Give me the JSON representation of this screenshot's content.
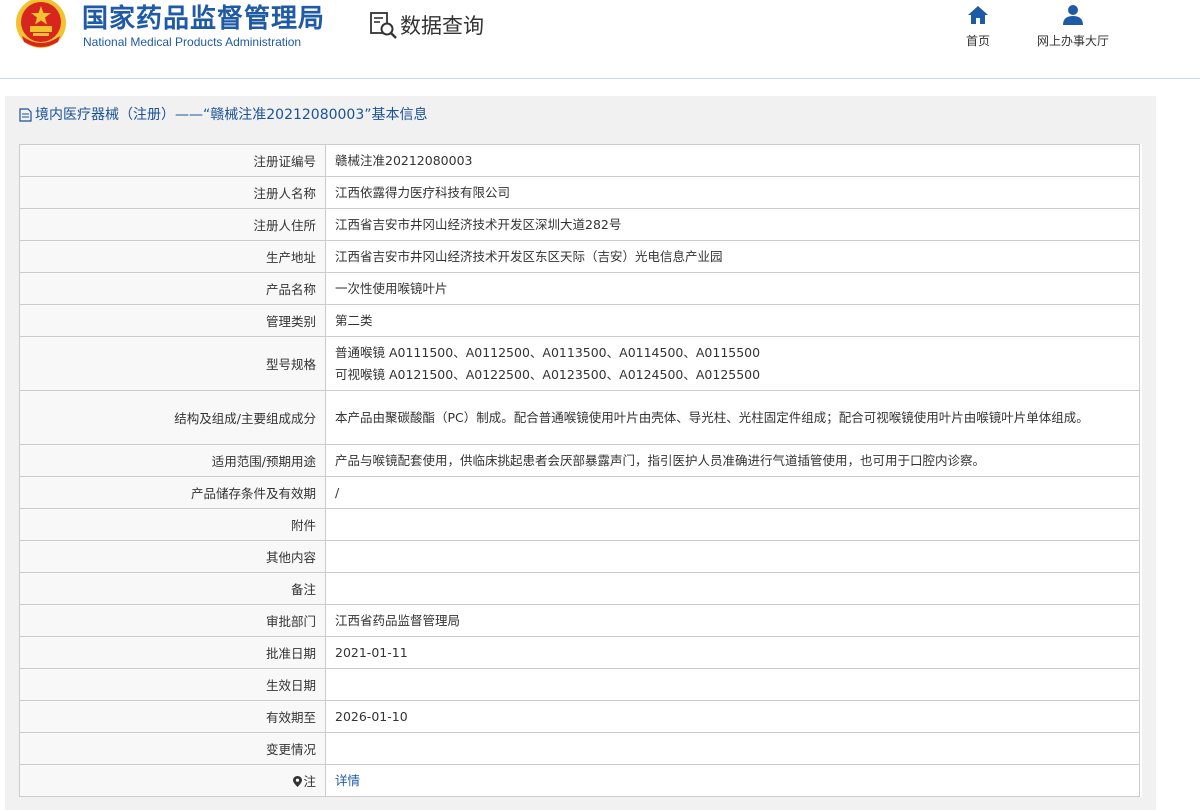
{
  "header": {
    "org_cn": "国家药品监督管理局",
    "org_en": "National Medical Products Administration",
    "query_label": "数据查询",
    "nav": {
      "home": "首页",
      "hall": "网上办事大厅"
    }
  },
  "panel": {
    "title": "境内医疗器械（注册）——“赣械注准20212080003”基本信息"
  },
  "rows": [
    {
      "label": "注册证编号",
      "value": "赣械注准20212080003"
    },
    {
      "label": "注册人名称",
      "value": "江西依露得力医疗科技有限公司"
    },
    {
      "label": "注册人住所",
      "value": "江西省吉安市井冈山经济技术开发区深圳大道282号"
    },
    {
      "label": "生产地址",
      "value": "江西省吉安市井冈山经济技术开发区东区天际（吉安）光电信息产业园"
    },
    {
      "label": "产品名称",
      "value": "一次性使用喉镜叶片"
    },
    {
      "label": "管理类别",
      "value": "第二类"
    },
    {
      "label": "型号规格",
      "value": "普通喉镜 A0111500、A0112500、A0113500、A0114500、A0115500",
      "value2": "可视喉镜 A0121500、A0122500、A0123500、A0124500、A0125500"
    },
    {
      "label": "结构及组成/主要组成成分",
      "value": "本产品由聚碳酸酯（PC）制成。配合普通喉镜使用叶片由壳体、导光柱、光柱固定件组成；配合可视喉镜使用叶片由喉镜叶片单体组成。"
    },
    {
      "label": "适用范围/预期用途",
      "value": "产品与喉镜配套使用，供临床挑起患者会厌部暴露声门，指引医护人员准确进行气道插管使用，也可用于口腔内诊察。"
    },
    {
      "label": "产品储存条件及有效期",
      "value": "/"
    },
    {
      "label": "附件",
      "value": ""
    },
    {
      "label": "其他内容",
      "value": ""
    },
    {
      "label": "备注",
      "value": ""
    },
    {
      "label": "审批部门",
      "value": "江西省药品监督管理局"
    },
    {
      "label": "批准日期",
      "value": "2021-01-11"
    },
    {
      "label": "生效日期",
      "value": ""
    },
    {
      "label": "有效期至",
      "value": "2026-01-10"
    },
    {
      "label": "变更情况",
      "value": ""
    },
    {
      "label": "注",
      "value": "详情"
    }
  ],
  "colors": {
    "brand_blue": "#1f5aa6",
    "emblem_red": "#d8261e",
    "emblem_gold": "#f2c230"
  },
  "icons": {
    "emblem": "national-emblem",
    "query": "search-document-icon",
    "home": "home-icon",
    "hall": "user-icon",
    "title": "document-icon",
    "note": "map-pin-icon"
  }
}
